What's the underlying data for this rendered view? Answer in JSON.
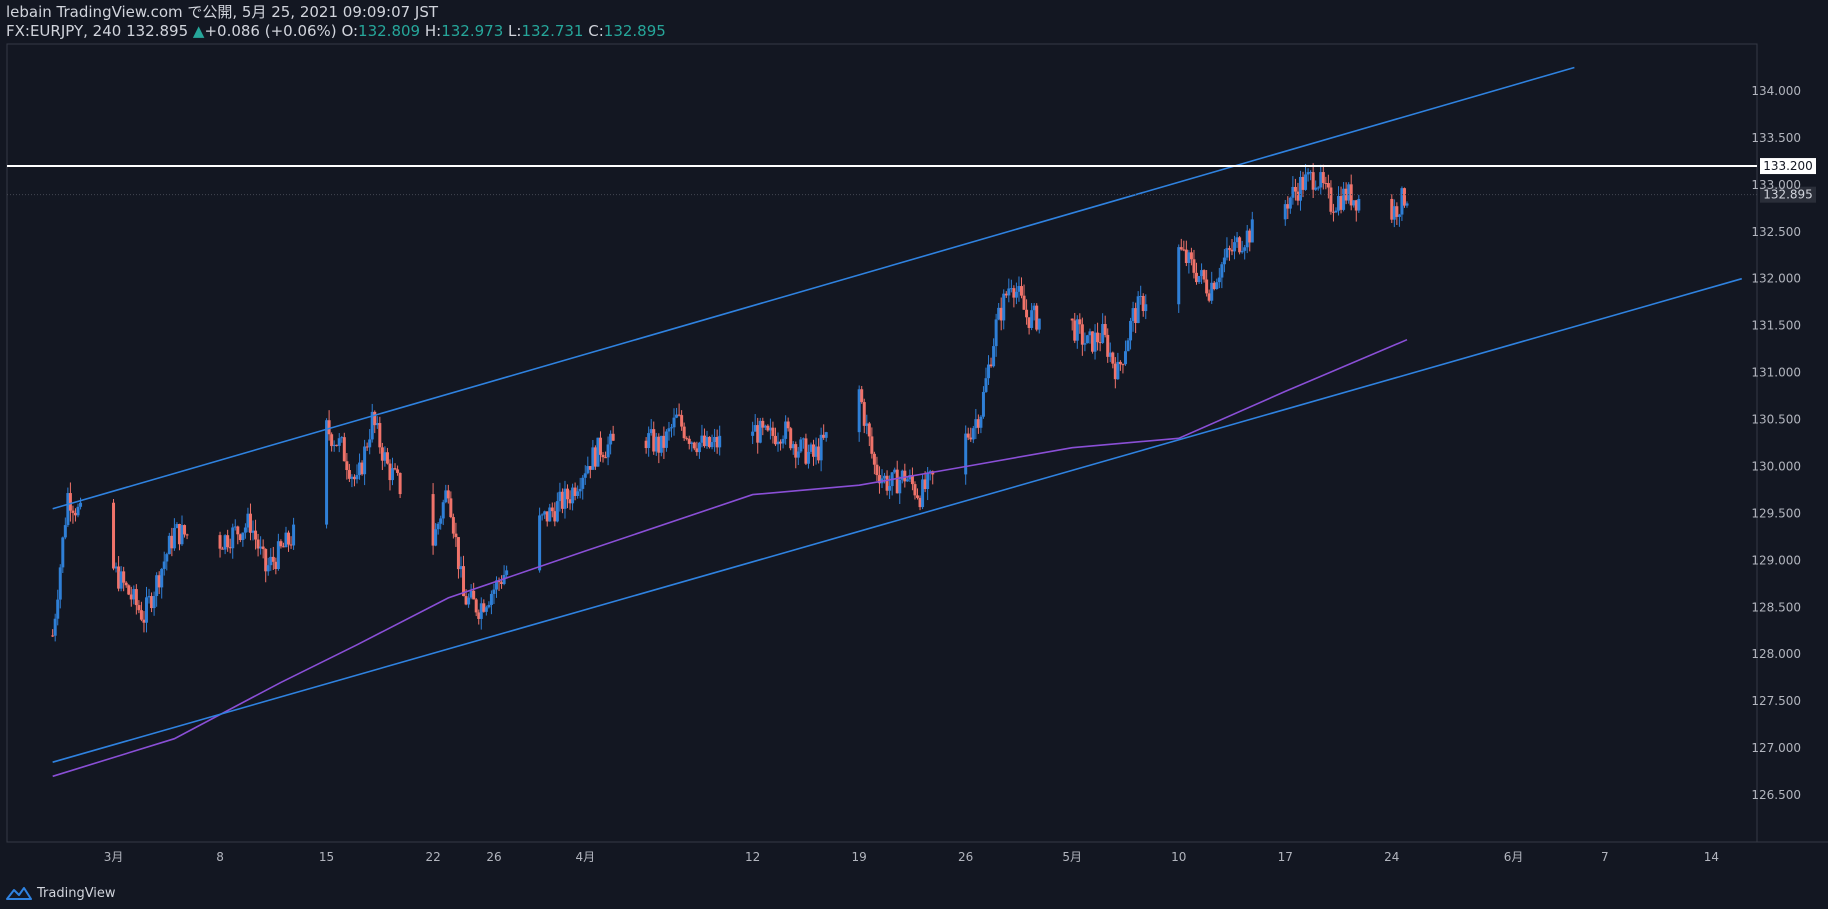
{
  "header": {
    "line1": "lebain TradingView.com で公開, 5月 25, 2021 09:09:07 JST",
    "symbol": "FX:EURJPY, 240",
    "last": "132.895",
    "change_arrow": "▲",
    "change": "+0.086 (+0.06%)",
    "o_label": "O:",
    "o": "132.809",
    "h_label": "H:",
    "h": "132.973",
    "l_label": "L:",
    "l": "132.731",
    "c_label": "C:",
    "c": "132.895"
  },
  "footer": {
    "brand": "TradingView"
  },
  "colors": {
    "background": "#131722",
    "up": "#2f7fd6",
    "down": "#f0736a",
    "trendline": "#2f82e0",
    "ma": "#8a4fd6",
    "level": "#ffffff",
    "axis_text": "#b2b5be",
    "header_value": "#26a69a"
  },
  "chart_data": {
    "type": "candlestick",
    "symbol": "FX:EURJPY",
    "interval": "240",
    "ylim": [
      126.0,
      134.5
    ],
    "y_ticks": [
      "126.500",
      "127.000",
      "127.500",
      "128.000",
      "128.500",
      "129.000",
      "129.500",
      "130.000",
      "130.500",
      "131.000",
      "131.500",
      "132.000",
      "132.500",
      "133.000",
      "133.500",
      "134.000"
    ],
    "x_ticks": [
      {
        "label": "3月",
        "date": "2021-03-01"
      },
      {
        "label": "8",
        "date": "2021-03-08"
      },
      {
        "label": "15",
        "date": "2021-03-15"
      },
      {
        "label": "22",
        "date": "2021-03-22"
      },
      {
        "label": "26",
        "date": "2021-03-26"
      },
      {
        "label": "4月",
        "date": "2021-04-01"
      },
      {
        "label": "12",
        "date": "2021-04-12"
      },
      {
        "label": "19",
        "date": "2021-04-19"
      },
      {
        "label": "26",
        "date": "2021-04-26"
      },
      {
        "label": "5月",
        "date": "2021-05-03"
      },
      {
        "label": "10",
        "date": "2021-05-10"
      },
      {
        "label": "17",
        "date": "2021-05-17"
      },
      {
        "label": "24",
        "date": "2021-05-24"
      },
      {
        "label": "6月",
        "date": "2021-06-01"
      },
      {
        "label": "7",
        "date": "2021-06-07"
      },
      {
        "label": "14",
        "date": "2021-06-14"
      }
    ],
    "price_path": [
      {
        "date": "2021-02-25",
        "close": 128.2
      },
      {
        "date": "2021-02-26",
        "close": 129.7
      },
      {
        "date": "2021-03-01",
        "close": 128.9
      },
      {
        "date": "2021-03-03",
        "close": 128.4
      },
      {
        "date": "2021-03-05",
        "close": 129.3
      },
      {
        "date": "2021-03-08",
        "close": 129.2
      },
      {
        "date": "2021-03-10",
        "close": 129.4
      },
      {
        "date": "2021-03-11",
        "close": 128.9
      },
      {
        "date": "2021-03-13",
        "close": 129.3
      },
      {
        "date": "2021-03-15",
        "close": 130.4
      },
      {
        "date": "2021-03-16",
        "close": 130.2
      },
      {
        "date": "2021-03-17",
        "close": 129.8
      },
      {
        "date": "2021-03-18",
        "close": 130.5
      },
      {
        "date": "2021-03-19",
        "close": 130.0
      },
      {
        "date": "2021-03-22",
        "close": 129.2
      },
      {
        "date": "2021-03-23",
        "close": 129.8
      },
      {
        "date": "2021-03-24",
        "close": 128.6
      },
      {
        "date": "2021-03-25",
        "close": 128.5
      },
      {
        "date": "2021-03-26",
        "close": 128.7
      },
      {
        "date": "2021-03-29",
        "close": 129.4
      },
      {
        "date": "2021-03-31",
        "close": 129.7
      },
      {
        "date": "2021-04-01",
        "close": 130.0
      },
      {
        "date": "2021-04-02",
        "close": 130.2
      },
      {
        "date": "2021-04-05",
        "close": 130.3
      },
      {
        "date": "2021-04-06",
        "close": 130.2
      },
      {
        "date": "2021-04-07",
        "close": 130.5
      },
      {
        "date": "2021-04-08",
        "close": 130.3
      },
      {
        "date": "2021-04-09",
        "close": 130.2
      },
      {
        "date": "2021-04-12",
        "close": 130.4
      },
      {
        "date": "2021-04-13",
        "close": 130.3
      },
      {
        "date": "2021-04-14",
        "close": 130.4
      },
      {
        "date": "2021-04-15",
        "close": 130.2
      },
      {
        "date": "2021-04-16",
        "close": 130.1
      },
      {
        "date": "2021-04-19",
        "close": 130.8
      },
      {
        "date": "2021-04-20",
        "close": 130.0
      },
      {
        "date": "2021-04-21",
        "close": 129.8
      },
      {
        "date": "2021-04-22",
        "close": 129.9
      },
      {
        "date": "2021-04-23",
        "close": 129.7
      },
      {
        "date": "2021-04-26",
        "close": 130.3
      },
      {
        "date": "2021-04-27",
        "close": 130.6
      },
      {
        "date": "2021-04-28",
        "close": 131.5
      },
      {
        "date": "2021-04-29",
        "close": 132.0
      },
      {
        "date": "2021-04-30",
        "close": 131.6
      },
      {
        "date": "2021-05-03",
        "close": 131.5
      },
      {
        "date": "2021-05-04",
        "close": 131.3
      },
      {
        "date": "2021-05-05",
        "close": 131.4
      },
      {
        "date": "2021-05-06",
        "close": 131.0
      },
      {
        "date": "2021-05-07",
        "close": 131.6
      },
      {
        "date": "2021-05-10",
        "close": 132.3
      },
      {
        "date": "2021-05-11",
        "close": 132.1
      },
      {
        "date": "2021-05-12",
        "close": 131.9
      },
      {
        "date": "2021-05-13",
        "close": 132.2
      },
      {
        "date": "2021-05-14",
        "close": 132.4
      },
      {
        "date": "2021-05-17",
        "close": 132.8
      },
      {
        "date": "2021-05-18",
        "close": 133.0
      },
      {
        "date": "2021-05-19",
        "close": 133.1
      },
      {
        "date": "2021-05-20",
        "close": 132.8
      },
      {
        "date": "2021-05-21",
        "close": 132.9
      },
      {
        "date": "2021-05-24",
        "close": 132.7
      },
      {
        "date": "2021-05-25",
        "close": 132.9
      }
    ],
    "moving_average": [
      {
        "date": "2021-02-25",
        "value": 126.7
      },
      {
        "date": "2021-03-05",
        "value": 127.1
      },
      {
        "date": "2021-03-12",
        "value": 127.7
      },
      {
        "date": "2021-03-17",
        "value": 128.1
      },
      {
        "date": "2021-03-23",
        "value": 128.6
      },
      {
        "date": "2021-04-01",
        "value": 129.1
      },
      {
        "date": "2021-04-12",
        "value": 129.7
      },
      {
        "date": "2021-04-19",
        "value": 129.8
      },
      {
        "date": "2021-04-26",
        "value": 130.0
      },
      {
        "date": "2021-05-03",
        "value": 130.2
      },
      {
        "date": "2021-05-10",
        "value": 130.3
      },
      {
        "date": "2021-05-17",
        "value": 130.8
      },
      {
        "date": "2021-05-25",
        "value": 131.35
      }
    ],
    "trendlines": [
      {
        "name": "upper-channel",
        "from": {
          "date": "2021-02-25",
          "value": 129.55
        },
        "to": {
          "date": "2021-06-05",
          "value": 134.25
        }
      },
      {
        "name": "lower-channel",
        "from": {
          "date": "2021-02-25",
          "value": 126.85
        },
        "to": {
          "date": "2021-06-16",
          "value": 132.0
        }
      }
    ],
    "horizontal_level": {
      "value": 133.2,
      "label": "133.200"
    },
    "last_price": {
      "value": 132.895,
      "label": "132.895"
    },
    "grid": false
  }
}
